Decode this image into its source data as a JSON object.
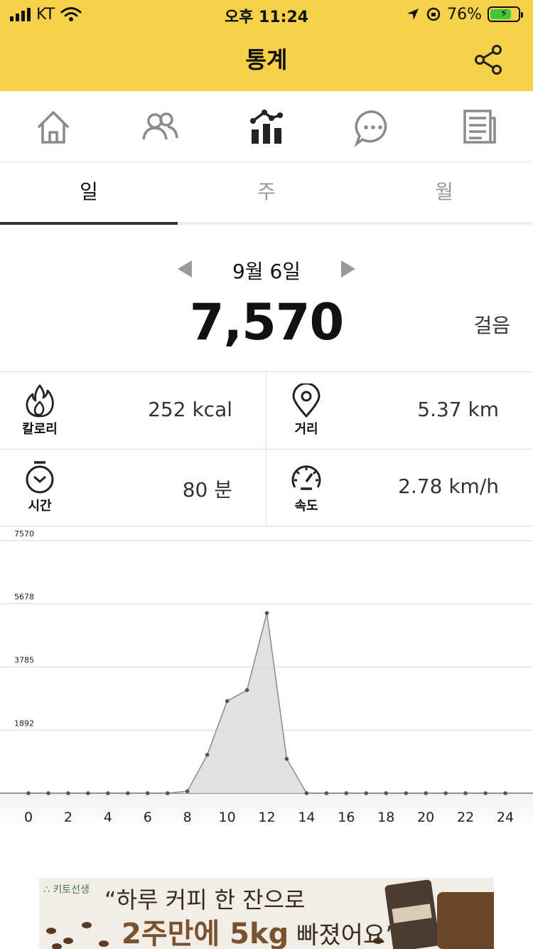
{
  "status_bar": {
    "carrier": "KT",
    "time": "오후 11:24",
    "battery_percent": "76%",
    "battery_level": 0.76
  },
  "header": {
    "title": "통계"
  },
  "icons": {
    "share": "share-icon",
    "nav": [
      "home-icon",
      "friends-icon",
      "statistics-icon",
      "chat-icon",
      "news-icon"
    ]
  },
  "tabs": [
    "일",
    "주",
    "월"
  ],
  "active_tab": 0,
  "date": "9월 6일",
  "steps": {
    "value": "7,570",
    "unit": "걸음"
  },
  "stats": {
    "calorie": {
      "label": "칼로리",
      "value": "252 kcal"
    },
    "distance": {
      "label": "거리",
      "value": "5.37 km"
    },
    "time": {
      "label": "시간",
      "value": "80 분"
    },
    "speed": {
      "label": "속도",
      "value": "2.78 km/h"
    }
  },
  "colors": {
    "header_yellow": "#f5d24a",
    "chart_fill": "#d9d9d9",
    "line": "#8a8a8a"
  },
  "chart_data": {
    "type": "area",
    "x": [
      0,
      1,
      2,
      3,
      4,
      5,
      6,
      7,
      8,
      9,
      10,
      11,
      12,
      13,
      14,
      15,
      16,
      17,
      18,
      19,
      20,
      21,
      22,
      23,
      24
    ],
    "series": [
      {
        "values": [
          0,
          0,
          0,
          0,
          0,
          0,
          0,
          0,
          60,
          1150,
          2760,
          3090,
          5400,
          1030,
          0,
          0,
          0,
          0,
          0,
          0,
          0,
          0,
          0,
          0,
          0
        ]
      }
    ],
    "xticks": [
      "0",
      "2",
      "4",
      "6",
      "8",
      "10",
      "12",
      "14",
      "16",
      "18",
      "20",
      "22",
      "24"
    ],
    "yticks": [
      "7570",
      "5678",
      "3785",
      "1892",
      "0"
    ],
    "ylim": [
      0,
      7570
    ],
    "xlim": [
      0,
      24
    ],
    "grid": true
  },
  "ad": {
    "brand": "∴ 키토선생",
    "line1": "“하루 커피 한 잔으로",
    "line2_bold": "2주만에 5kg",
    "line2_rest": " 빠졌어요”"
  }
}
